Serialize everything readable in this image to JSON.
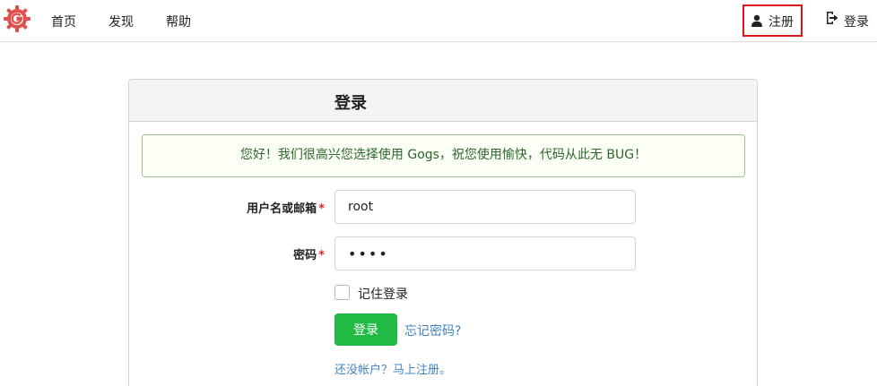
{
  "navbar": {
    "logo_icon": "gogs-logo-icon",
    "items": [
      {
        "label": "首页"
      },
      {
        "label": "发现"
      },
      {
        "label": "帮助"
      }
    ],
    "register": {
      "icon": "user-icon",
      "label": "注册"
    },
    "login": {
      "icon": "sign-in-icon",
      "label": "登录"
    }
  },
  "card": {
    "title": "登录",
    "message": "您好！我们很高兴您选择使用 Gogs，祝您使用愉快，代码从此无 BUG！",
    "username_label": "用户名或邮箱",
    "password_label": "密码",
    "required_mark": "*",
    "username_value": "root",
    "password_value": "••••",
    "remember_label": "记住登录",
    "remember_checked": false,
    "submit_label": "登录",
    "forgot_label": "忘记密码?",
    "signup_label": "还没帐户？马上注册。"
  },
  "colors": {
    "accent_green": "#21ba45",
    "link_blue": "#4183c4",
    "message_bg": "#fcfff5",
    "message_text": "#2c662d",
    "highlight_red": "#d9181c",
    "logo_red": "#d9534f"
  }
}
